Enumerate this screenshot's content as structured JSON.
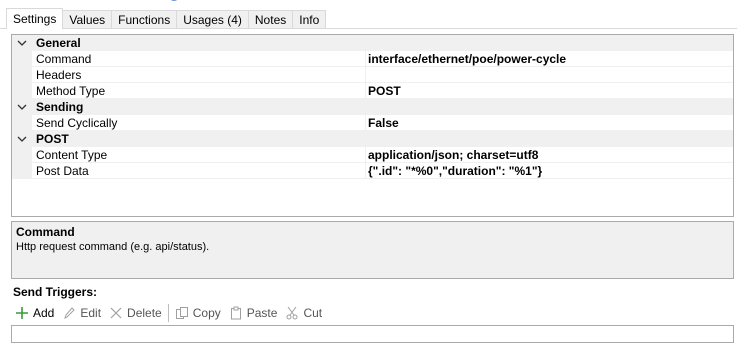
{
  "tabs": [
    {
      "label": "Settings",
      "active": true
    },
    {
      "label": "Values"
    },
    {
      "label": "Functions"
    },
    {
      "label": "Usages (4)"
    },
    {
      "label": "Notes"
    },
    {
      "label": "Info"
    }
  ],
  "grid": {
    "categories": {
      "general": "General",
      "sending": "Sending",
      "post": "POST"
    },
    "props": {
      "command": {
        "name": "Command",
        "value": "interface/ethernet/poe/power-cycle"
      },
      "headers": {
        "name": "Headers",
        "value": ""
      },
      "method": {
        "name": "Method Type",
        "value": "POST"
      },
      "send_cyclically": {
        "name": "Send Cyclically",
        "value": "False"
      },
      "content_type": {
        "name": "Content Type",
        "value": "application/json; charset=utf8"
      },
      "post_data": {
        "name": "Post Data",
        "value": "{\".id\": \"*%0\",\"duration\": \"%1\"}"
      }
    }
  },
  "help": {
    "title": "Command",
    "description": "Http request command (e.g. api/status)."
  },
  "triggers": {
    "label": "Send Triggers:",
    "toolbar": {
      "add": "Add",
      "edit": "Edit",
      "delete": "Delete",
      "copy": "Copy",
      "paste": "Paste",
      "cut": "Cut"
    }
  },
  "colors": {
    "add_icon": "#3a9a3a",
    "disabled_icon": "#a0a0a0",
    "grid_border": "#aaaaaa",
    "category_bg": "#f0f0f0"
  }
}
